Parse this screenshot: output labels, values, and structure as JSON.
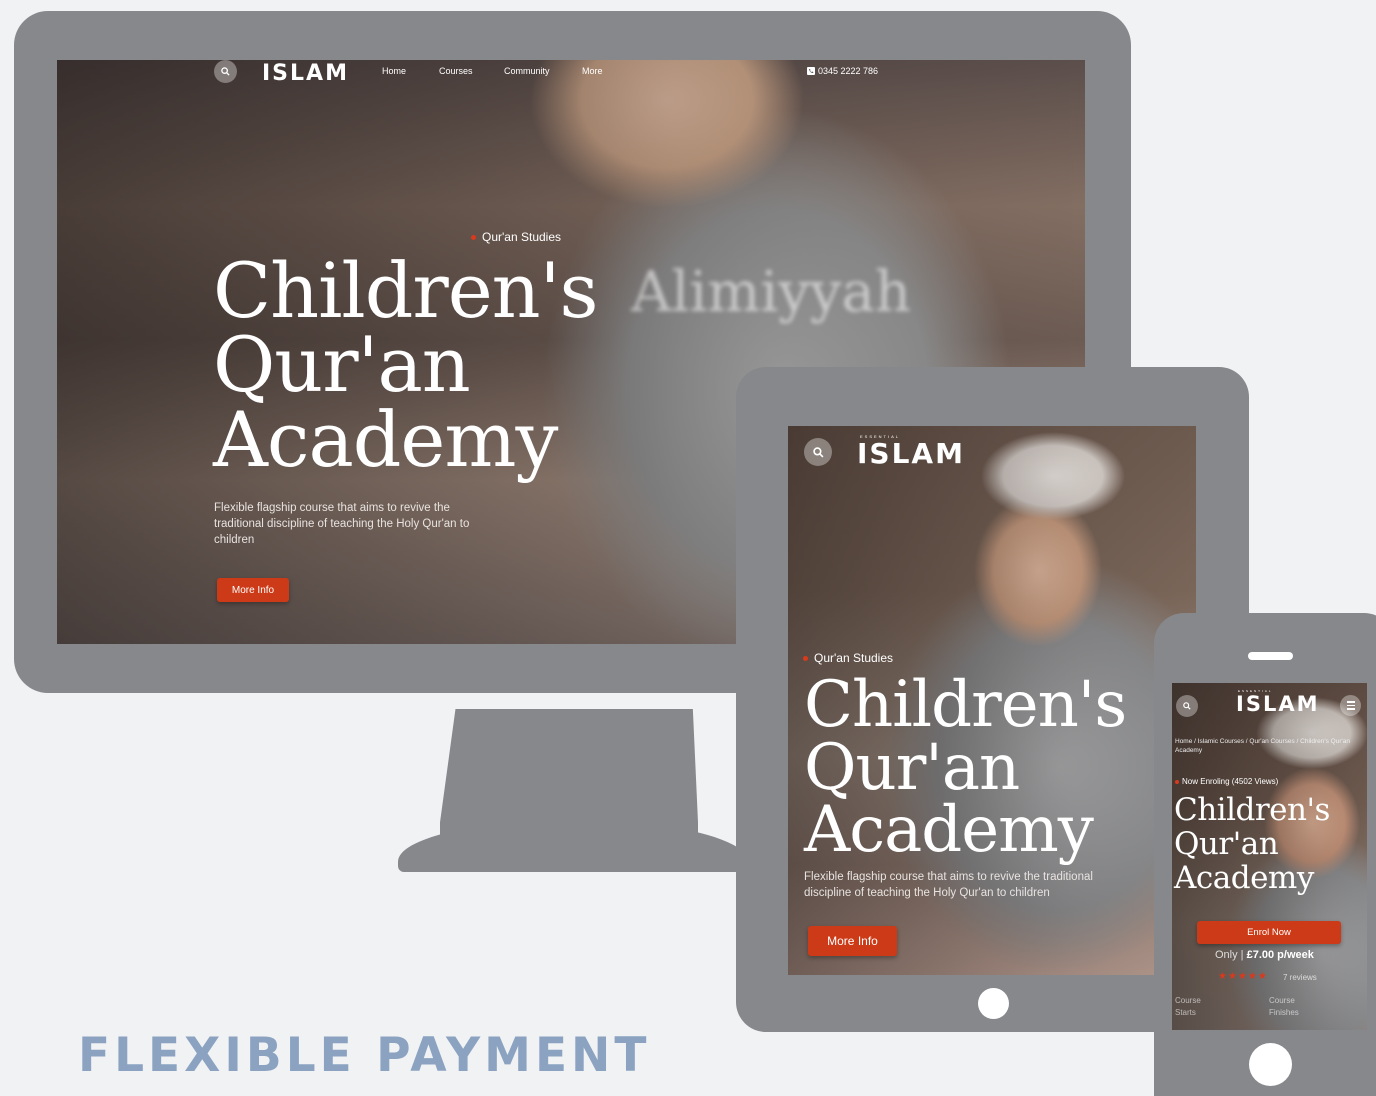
{
  "brand": {
    "logo": "ISLAM",
    "logo_top": "ESSENTIAL"
  },
  "desktop": {
    "nav": [
      {
        "label": "Home"
      },
      {
        "label": "Courses"
      },
      {
        "label": "Community"
      },
      {
        "label": "More"
      }
    ],
    "phone": "0345 2222 786",
    "tag": "Qur'an Studies",
    "headline": [
      "Children's",
      "Qur'an",
      "Academy"
    ],
    "description": "Flexible flagship course that aims to revive the traditional discipline of teaching the Holy Qur'an to children",
    "cta": "More Info",
    "watermark": "Alimiyyah"
  },
  "tablet": {
    "tag": "Qur'an Studies",
    "headline": [
      "Children's",
      "Qur'an",
      "Academy"
    ],
    "description": "Flexible flagship course that aims to revive the traditional discipline of teaching the Holy Qur'an to children",
    "cta": "More Info"
  },
  "mobile": {
    "breadcrumbs": "Home / Islamic Courses / Qur'an Courses / Children's Qur'an Academy",
    "tag": "Now Enroling (4502 Views)",
    "headline": [
      "Children's",
      "Qur'an",
      "Academy"
    ],
    "cta": "Enrol Now",
    "price_prefix": "Only |",
    "price": "£7.00 p/week",
    "stars": "★★★★★",
    "rating": 5,
    "reviews": "7 reviews",
    "stat_left": "Course Starts",
    "stat_right": "Course Finishes"
  },
  "tagline": "FLEXIBLE PAYMENT",
  "colors": {
    "device": "#86888b",
    "accent": "#cd3a17",
    "tagline": "#8ba3c1",
    "background": "#f1f2f4"
  }
}
